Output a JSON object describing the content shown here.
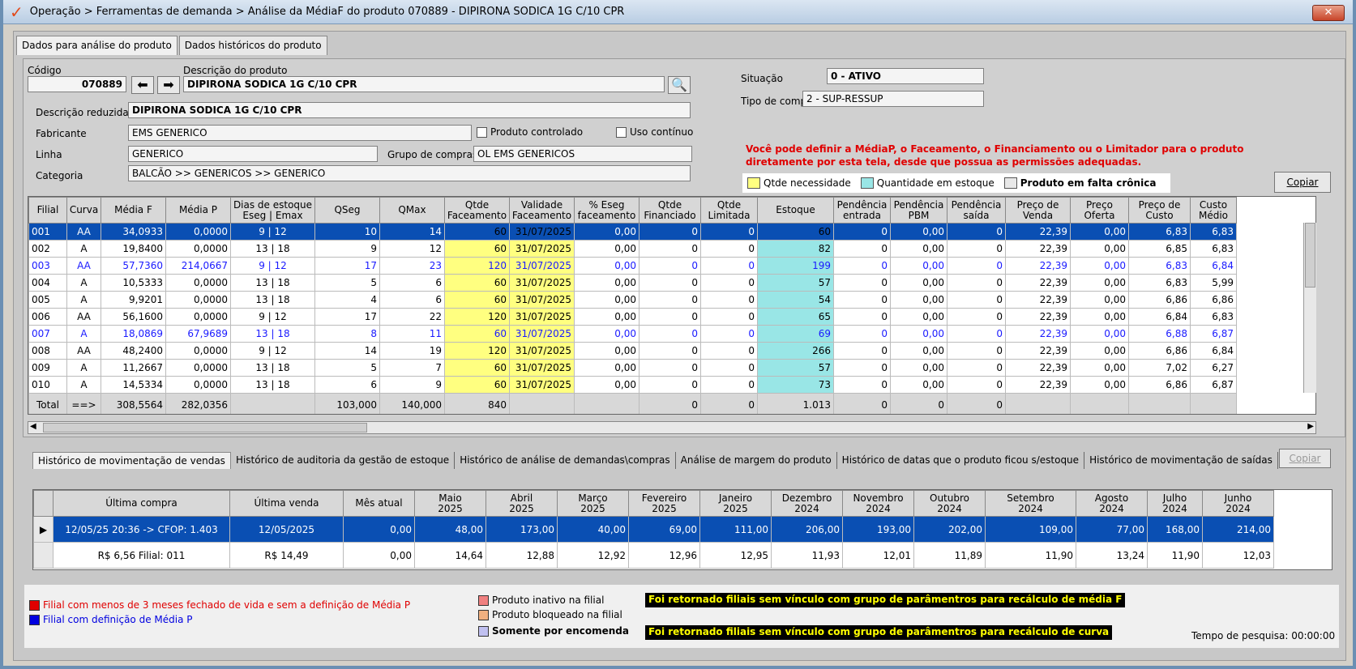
{
  "window": {
    "title": "Operação > Ferramentas de demanda > Análise da MédiaF do produto 070889 - DIPIRONA SODICA 1G C/10 CPR",
    "close_label": "✕"
  },
  "top_tabs": [
    "Dados para análise do produto",
    "Dados históricos do produto"
  ],
  "product": {
    "codigo_label": "Código",
    "codigo": "070889",
    "descricao_label": "Descrição do produto",
    "descricao": "DIPIRONA SODICA 1G C/10 CPR",
    "descricao_reduzida_label": "Descrição reduzida",
    "descricao_reduzida": "DIPIRONA SODICA 1G C/10 CPR",
    "fabricante_label": "Fabricante",
    "fabricante": "EMS GENERICO",
    "linha_label": "Linha",
    "linha": "GENERICO",
    "categoria_label": "Categoria",
    "categoria": "BALCÃO >> GENERICOS >> GENERICO",
    "grupo_compras_label": "Grupo de compras",
    "grupo_compras": "OL EMS GENERICOS",
    "produto_controlado_label": "Produto controlado",
    "uso_continuo_label": "Uso contínuo",
    "situacao_label": "Situação",
    "situacao": "0 - ATIVO",
    "tipo_compra_label": "Tipo de compra",
    "tipo_compra": "2 - SUP-RESSUP"
  },
  "notice": "Você pode definir a MédiaP, o Faceamento, o Financiamento ou o Limitador para o produto diretamente por esta tela, desde que possua as permissões adequadas.",
  "legend_top": [
    {
      "label": "Qtde necessidade",
      "color": "#ffff80"
    },
    {
      "label": "Quantidade em estoque",
      "color": "#99e6e6"
    },
    {
      "label": "Produto em falta crônica",
      "color": "#e8e8e8"
    }
  ],
  "copiar_label": "Copiar",
  "grid": {
    "headers": [
      "Filial",
      "Curva",
      "Média F",
      "Média P",
      "Dias de estoque\nEseg | Emax",
      "QSeg",
      "QMax",
      "Qtde\nFaceamento",
      "Validade\nFaceamento",
      "% Eseg\nfaceamento",
      "Qtde\nFinanciado",
      "Qtde\nLimitada",
      "Estoque",
      "Pendência\nentrada",
      "Pendência\nPBM",
      "Pendência\nsaída",
      "Preço de\nVenda",
      "Preço\nOferta",
      "Preço de\nCusto",
      "Custo\nMédio"
    ],
    "rows": [
      [
        "001",
        "AA",
        "34,0933",
        "0,0000",
        "9  |  12",
        "10",
        "14",
        "60",
        "31/07/2025",
        "0,00",
        "0",
        "0",
        "60",
        "0",
        "0,00",
        "0",
        "22,39",
        "0,00",
        "6,83",
        "6,83"
      ],
      [
        "002",
        "A",
        "19,8400",
        "0,0000",
        "13  |  18",
        "9",
        "12",
        "60",
        "31/07/2025",
        "0,00",
        "0",
        "0",
        "82",
        "0",
        "0,00",
        "0",
        "22,39",
        "0,00",
        "6,85",
        "6,83"
      ],
      [
        "003",
        "AA",
        "57,7360",
        "214,0667",
        "9  |  12",
        "17",
        "23",
        "120",
        "31/07/2025",
        "0,00",
        "0",
        "0",
        "199",
        "0",
        "0,00",
        "0",
        "22,39",
        "0,00",
        "6,83",
        "6,84"
      ],
      [
        "004",
        "A",
        "10,5333",
        "0,0000",
        "13  |  18",
        "5",
        "6",
        "60",
        "31/07/2025",
        "0,00",
        "0",
        "0",
        "57",
        "0",
        "0,00",
        "0",
        "22,39",
        "0,00",
        "6,83",
        "5,99"
      ],
      [
        "005",
        "A",
        "9,9201",
        "0,0000",
        "13  |  18",
        "4",
        "6",
        "60",
        "31/07/2025",
        "0,00",
        "0",
        "0",
        "54",
        "0",
        "0,00",
        "0",
        "22,39",
        "0,00",
        "6,86",
        "6,86"
      ],
      [
        "006",
        "AA",
        "56,1600",
        "0,0000",
        "9  |  12",
        "17",
        "22",
        "120",
        "31/07/2025",
        "0,00",
        "0",
        "0",
        "65",
        "0",
        "0,00",
        "0",
        "22,39",
        "0,00",
        "6,84",
        "6,83"
      ],
      [
        "007",
        "A",
        "18,0869",
        "67,9689",
        "13  |  18",
        "8",
        "11",
        "60",
        "31/07/2025",
        "0,00",
        "0",
        "0",
        "69",
        "0",
        "0,00",
        "0",
        "22,39",
        "0,00",
        "6,88",
        "6,87"
      ],
      [
        "008",
        "AA",
        "48,2400",
        "0,0000",
        "9  |  12",
        "14",
        "19",
        "120",
        "31/07/2025",
        "0,00",
        "0",
        "0",
        "266",
        "0",
        "0,00",
        "0",
        "22,39",
        "0,00",
        "6,86",
        "6,84"
      ],
      [
        "009",
        "A",
        "11,2667",
        "0,0000",
        "13  |  18",
        "5",
        "7",
        "60",
        "31/07/2025",
        "0,00",
        "0",
        "0",
        "57",
        "0",
        "0,00",
        "0",
        "22,39",
        "0,00",
        "7,02",
        "6,27"
      ],
      [
        "010",
        "A",
        "14,5334",
        "0,0000",
        "13  |  18",
        "6",
        "9",
        "60",
        "31/07/2025",
        "0,00",
        "0",
        "0",
        "73",
        "0",
        "0,00",
        "0",
        "22,39",
        "0,00",
        "6,86",
        "6,87"
      ]
    ],
    "row_styles": [
      "sel",
      "",
      "blue",
      "",
      "",
      "",
      "blue",
      "",
      "",
      ""
    ],
    "total": [
      "Total",
      "==>",
      "308,5564",
      "282,0356",
      "",
      "103,000",
      "140,000",
      "840",
      "",
      "",
      "0",
      "0",
      "1.013",
      "0",
      "0",
      "0",
      "",
      "",
      "",
      ""
    ]
  },
  "bottom_tabs": [
    "Histórico de movimentação de vendas",
    "Histórico de auditoria da gestão de estoque",
    "Histórico de análise de demandas\\compras",
    "Análise de margem do produto",
    "Histórico de datas que o produto ficou s/estoque",
    "Histórico de movimentação de saídas"
  ],
  "history": {
    "headers": [
      "Última compra",
      "Última venda",
      "Mês atual",
      "Maio\n2025",
      "Abril\n2025",
      "Março\n2025",
      "Fevereiro\n2025",
      "Janeiro\n2025",
      "Dezembro\n2024",
      "Novembro\n2024",
      "Outubro\n2024",
      "Setembro\n2024",
      "Agosto\n2024",
      "Julho\n2024",
      "Junho\n2024"
    ],
    "rows": [
      [
        "12/05/25 20:36 -> CFOP: 1.403",
        "12/05/2025",
        "0,00",
        "48,00",
        "173,00",
        "40,00",
        "69,00",
        "111,00",
        "206,00",
        "193,00",
        "202,00",
        "109,00",
        "77,00",
        "168,00",
        "214,00"
      ],
      [
        "R$ 6,56 Filial: 011",
        "R$ 14,49",
        "0,00",
        "14,64",
        "12,88",
        "12,92",
        "12,96",
        "12,95",
        "11,93",
        "12,01",
        "11,89",
        "11,90",
        "13,24",
        "11,90",
        "12,03"
      ]
    ]
  },
  "footer": {
    "legend1": "Filial com menos de 3 meses fechado de vida e sem a definição de Média P",
    "legend1_color": "#e00000",
    "legend2": "Filial com definição de Média P",
    "legend2_color": "#0000e0",
    "legend3": "Produto inativo na filial",
    "legend4": "Produto bloqueado na filial",
    "legend5": "Somente por encomenda",
    "msg1": "Foi retornado filiais sem vínculo com grupo de parâmentros para recálculo de média F",
    "msg2": "Foi retornado filiais sem vínculo com grupo de parâmentros para recálculo de curva",
    "tempo": "Tempo de pesquisa: 00:00:00"
  }
}
